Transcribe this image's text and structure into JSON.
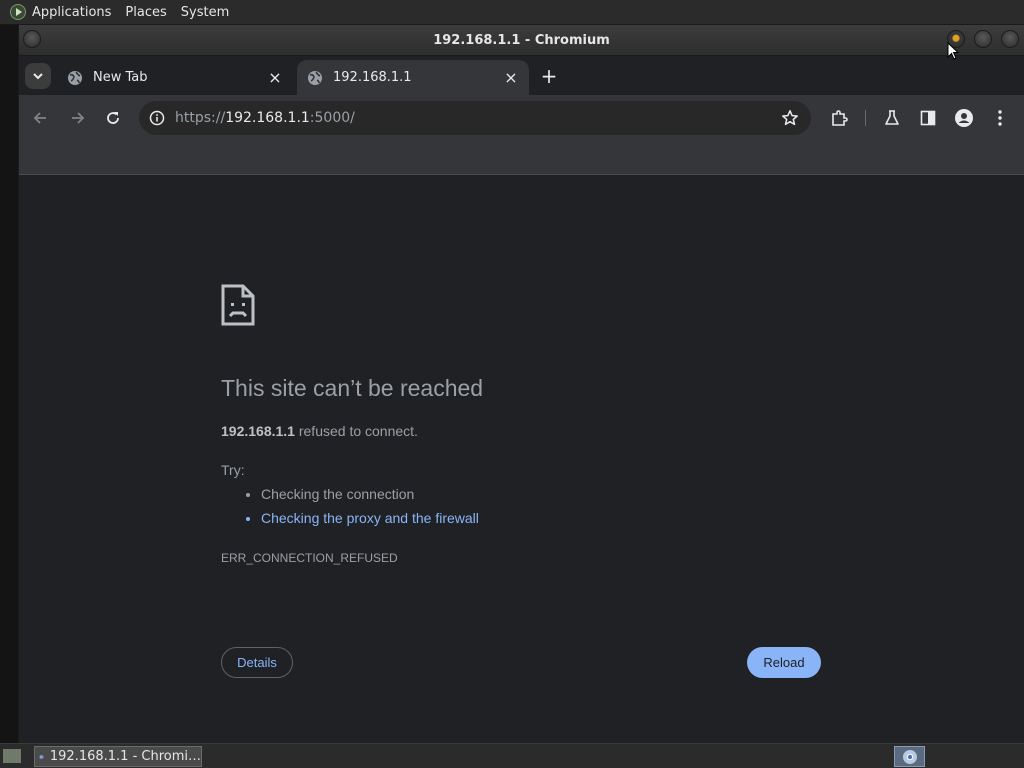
{
  "desktop": {
    "menus": [
      "Applications",
      "Places",
      "System"
    ]
  },
  "window": {
    "title": "192.168.1.1 - Chromium"
  },
  "tabs": [
    {
      "label": "New Tab",
      "active": false
    },
    {
      "label": "192.168.1.1",
      "active": true
    }
  ],
  "tab_close_glyph": "×",
  "new_tab_glyph": "+",
  "omnibox": {
    "scheme": "https://",
    "host": "192.168.1.1",
    "rest": ":5000/"
  },
  "error_page": {
    "heading": "This site can’t be reached",
    "host": "192.168.1.1",
    "description_suffix": " refused to connect.",
    "try_label": "Try:",
    "suggestions": [
      "Checking the connection",
      "Checking the proxy and the firewall"
    ],
    "error_code": "ERR_CONNECTION_REFUSED",
    "details_label": "Details",
    "reload_label": "Reload"
  },
  "taskbar": {
    "task_label": "192.168.1.1 - Chromi…"
  },
  "colors": {
    "page_bg": "#202124",
    "toolbar_bg": "#35363a",
    "link": "#8ab4f8",
    "reload_bg": "#8ab4f8",
    "text_secondary": "#9aa0a6"
  },
  "icons": [
    "tab-search-icon",
    "globe-icon",
    "close-icon",
    "plus-icon",
    "back-arrow-icon",
    "forward-arrow-icon",
    "reload-icon",
    "info-icon",
    "star-icon",
    "extensions-icon",
    "labs-flask-icon",
    "side-panel-icon",
    "profile-icon",
    "more-vert-icon",
    "sad-page-icon",
    "chromium-icon"
  ]
}
